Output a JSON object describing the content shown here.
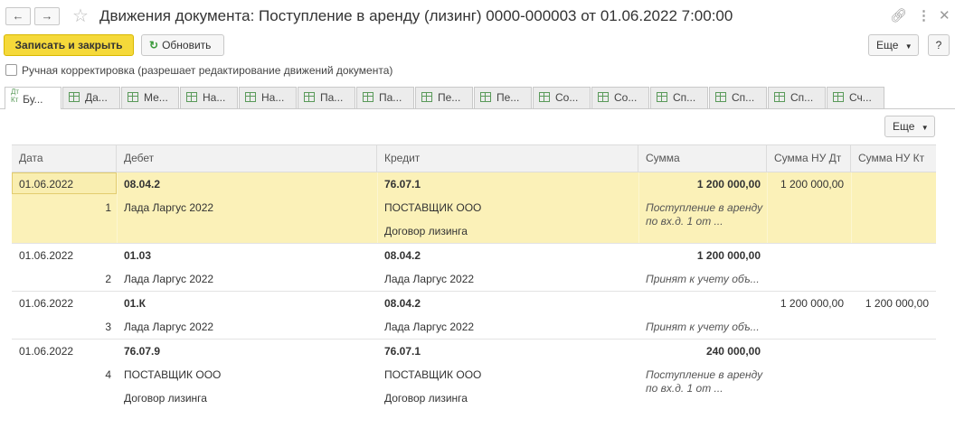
{
  "window": {
    "back_icon": "arrow-left-icon",
    "forward_icon": "arrow-right-icon",
    "title": "Движения документа: Поступление в аренду (лизинг) 0000-000003 от 01.06.2022 7:00:00",
    "link_icon": "link-icon",
    "more_icon": "more-vertical-icon",
    "close_icon": "close-icon"
  },
  "toolbar": {
    "save_close_label": "Записать и закрыть",
    "refresh_label": "Обновить",
    "more_label": "Еще",
    "help_label": "?"
  },
  "manual_edit": {
    "label": "Ручная корректировка (разрешает редактирование движений документа)",
    "checked": false
  },
  "tabs": [
    {
      "label": "Бу...",
      "icon": "dt-kt-icon",
      "active": true
    },
    {
      "label": "Да...",
      "icon": "table-icon",
      "active": false
    },
    {
      "label": "Ме...",
      "icon": "table-icon",
      "active": false
    },
    {
      "label": "На...",
      "icon": "table-icon",
      "active": false
    },
    {
      "label": "На...",
      "icon": "table-icon",
      "active": false
    },
    {
      "label": "Па...",
      "icon": "table-icon",
      "active": false
    },
    {
      "label": "Па...",
      "icon": "table-icon",
      "active": false
    },
    {
      "label": "Пе...",
      "icon": "table-icon",
      "active": false
    },
    {
      "label": "Пе...",
      "icon": "table-icon",
      "active": false
    },
    {
      "label": "Со...",
      "icon": "table-icon",
      "active": false
    },
    {
      "label": "Со...",
      "icon": "table-icon",
      "active": false
    },
    {
      "label": "Сп...",
      "icon": "table-icon",
      "active": false
    },
    {
      "label": "Сп...",
      "icon": "table-icon",
      "active": false
    },
    {
      "label": "Сп...",
      "icon": "table-icon",
      "active": false
    },
    {
      "label": "Сч...",
      "icon": "table-icon",
      "active": false
    }
  ],
  "grid_more_label": "Еще",
  "columns": [
    "Дата",
    "Дебет",
    "Кредит",
    "Сумма",
    "Сумма НУ Дт",
    "Сумма НУ Кт"
  ],
  "rows": [
    {
      "date": "01.06.2022",
      "num": "1",
      "debit": "08.04.2",
      "debit_sub1": "Лада Ларгус 2022",
      "debit_sub2": "",
      "credit": "76.07.1",
      "credit_sub1": "ПОСТАВЩИК ООО",
      "credit_sub2": "Договор лизинга",
      "sum": "1 200 000,00",
      "content1": "Поступление в аренду",
      "content2": "по вх.д. 1 от ...",
      "nu_dt": "1 200 000,00",
      "nu_kt": "",
      "selected": true
    },
    {
      "date": "01.06.2022",
      "num": "2",
      "debit": "01.03",
      "debit_sub1": "Лада Ларгус 2022",
      "debit_sub2": "",
      "credit": "08.04.2",
      "credit_sub1": "Лада Ларгус 2022",
      "credit_sub2": "",
      "sum": "1 200 000,00",
      "content1": "Принят к учету объ...",
      "content2": "",
      "nu_dt": "",
      "nu_kt": "",
      "selected": false
    },
    {
      "date": "01.06.2022",
      "num": "3",
      "debit": "01.К",
      "debit_sub1": "Лада Ларгус 2022",
      "debit_sub2": "",
      "credit": "08.04.2",
      "credit_sub1": "Лада Ларгус 2022",
      "credit_sub2": "",
      "sum": "",
      "content1": "Принят к учету объ...",
      "content2": "",
      "nu_dt": "1 200 000,00",
      "nu_kt": "1 200 000,00",
      "selected": false
    },
    {
      "date": "01.06.2022",
      "num": "4",
      "debit": "76.07.9",
      "debit_sub1": "ПОСТАВЩИК ООО",
      "debit_sub2": "Договор лизинга",
      "credit": "76.07.1",
      "credit_sub1": "ПОСТАВЩИК ООО",
      "credit_sub2": "Договор лизинга",
      "sum": "240 000,00",
      "content1": "Поступление в аренду",
      "content2": "по вх.д. 1 от ...",
      "nu_dt": "",
      "nu_kt": "",
      "selected": false
    }
  ]
}
